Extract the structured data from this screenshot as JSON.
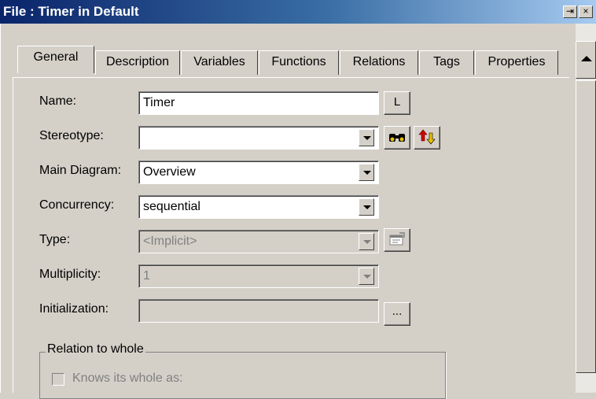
{
  "window": {
    "title": "File : Timer in Default",
    "pin_glyph": "⇥",
    "close_glyph": "×"
  },
  "tabs": [
    {
      "label": "General",
      "active": true
    },
    {
      "label": "Description",
      "active": false
    },
    {
      "label": "Variables",
      "active": false
    },
    {
      "label": "Functions",
      "active": false
    },
    {
      "label": "Relations",
      "active": false
    },
    {
      "label": "Tags",
      "active": false
    },
    {
      "label": "Properties",
      "active": false
    }
  ],
  "form": {
    "name_label": "Name:",
    "name_value": "Timer",
    "l_button": "L",
    "stereotype_label": "Stereotype:",
    "stereotype_value": "",
    "main_diagram_label": "Main Diagram:",
    "main_diagram_value": "Overview",
    "concurrency_label": "Concurrency:",
    "concurrency_value": "sequential",
    "type_label": "Type:",
    "type_value": "<Implicit>",
    "multiplicity_label": "Multiplicity:",
    "multiplicity_value": "1",
    "initialization_label": "Initialization:",
    "initialization_value": "",
    "ellipsis_button": "..."
  },
  "relation_group": {
    "title": "Relation to whole",
    "checkbox_label": "Knows its whole as:"
  },
  "colors": {
    "title_bar_start": "#0a246a",
    "title_bar_end": "#a6caf0",
    "face": "#d4d0c8"
  }
}
